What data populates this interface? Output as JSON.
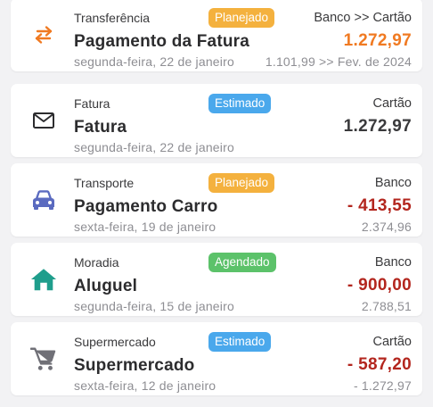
{
  "colors": {
    "planned": "#f4b13e",
    "estimated": "#4aa8ec",
    "scheduled": "#5cc26a",
    "amount_orange": "#f07a22",
    "amount_dark": "#3a3a3c",
    "amount_red": "#b3261e"
  },
  "transactions": [
    {
      "category": "Transferência",
      "badge": "Planejado",
      "account": "Banco >> Cartão",
      "title": "Pagamento da Fatura",
      "amount": "1.272,97",
      "date": "segunda-feira, 22 de janeiro",
      "subtext": "1.101,99 >> Fev. de 2024",
      "icon": "transfer-icon"
    },
    {
      "category": "Fatura",
      "badge": "Estimado",
      "account": "Cartão",
      "title": "Fatura",
      "amount": "1.272,97",
      "date": "segunda-feira, 22 de janeiro",
      "subtext": "",
      "icon": "envelope-icon"
    },
    {
      "category": "Transporte",
      "badge": "Planejado",
      "account": "Banco",
      "title": "Pagamento Carro",
      "amount": "- 413,55",
      "date": "sexta-feira, 19 de janeiro",
      "subtext": "2.374,96",
      "icon": "car-icon"
    },
    {
      "category": "Moradia",
      "badge": "Agendado",
      "account": "Banco",
      "title": "Aluguel",
      "amount": "- 900,00",
      "date": "segunda-feira, 15 de janeiro",
      "subtext": "2.788,51",
      "icon": "house-icon"
    },
    {
      "category": "Supermercado",
      "badge": "Estimado",
      "account": "Cartão",
      "title": "Supermercado",
      "amount": "- 587,20",
      "date": "sexta-feira, 12 de janeiro",
      "subtext": "- 1.272,97",
      "icon": "shopping-cart-icon"
    }
  ]
}
